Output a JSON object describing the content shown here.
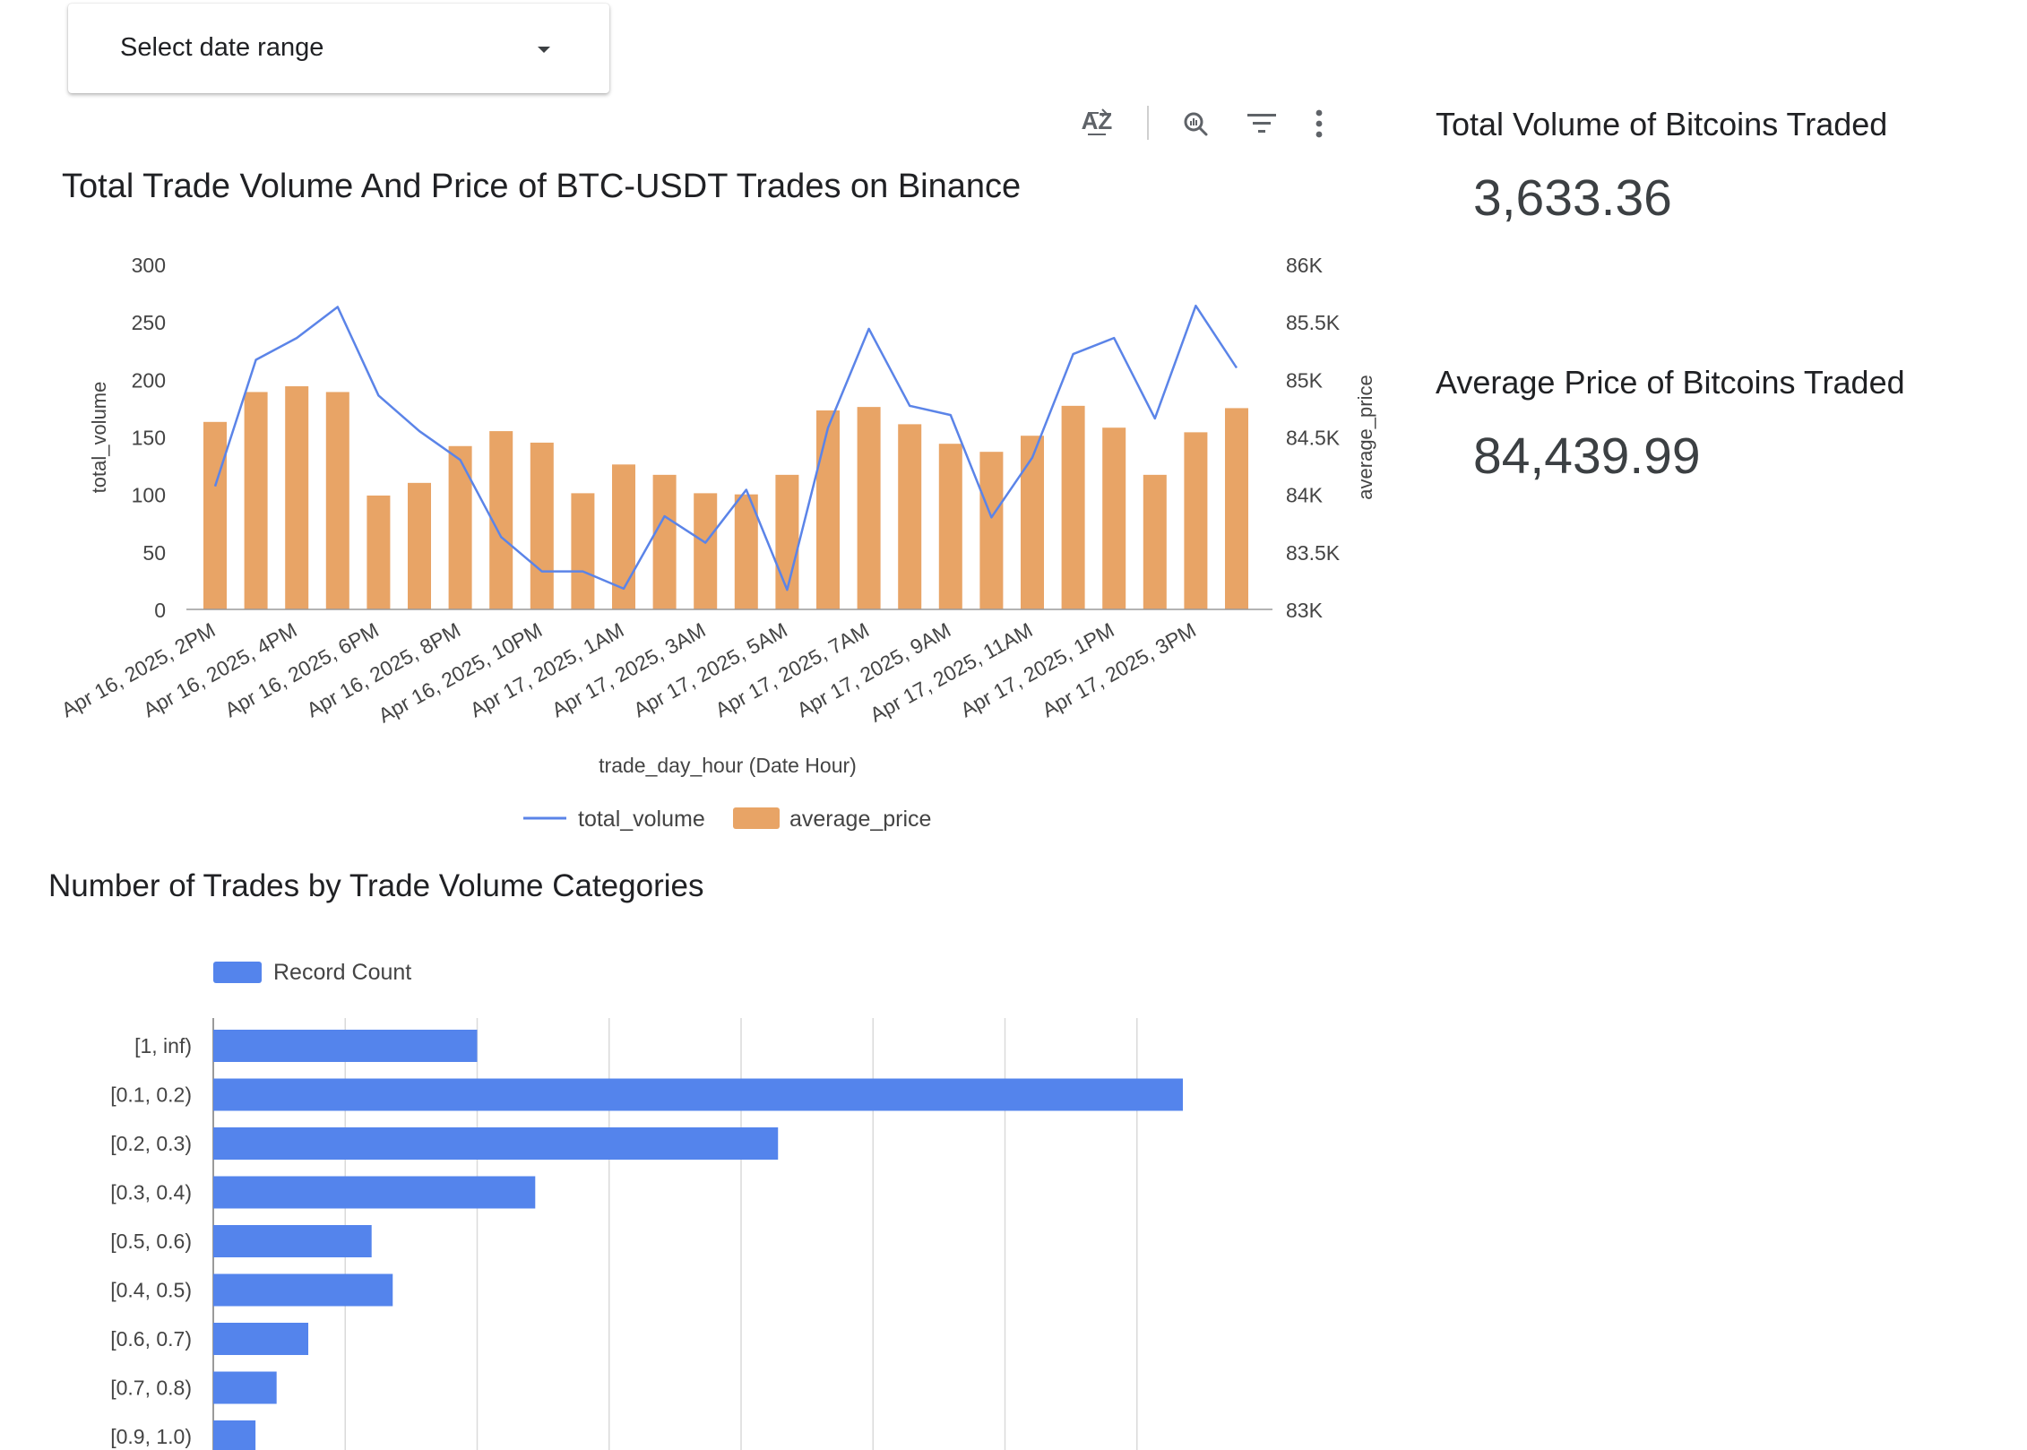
{
  "controls": {
    "date_range_label": "Select date range"
  },
  "toolbar": {
    "icons": [
      "sort-az-icon",
      "explore-chart-icon",
      "filter-icon",
      "more-vert-icon"
    ]
  },
  "scorecards": {
    "total_volume": {
      "title": "Total Volume of Bitcoins Traded",
      "value": "3,633.36"
    },
    "average_price": {
      "title": "Average Price of Bitcoins Traded",
      "value": "84,439.99"
    }
  },
  "colors": {
    "line": "#5b84e8",
    "bar_orange": "#e8a466",
    "bar_blue": "#5484ec",
    "grid": "#dadada",
    "axis": "#9a9a9a",
    "tick_text": "#444444"
  },
  "chart_data": [
    {
      "type": "bar",
      "title": "Total Trade Volume And Price of BTC-USDT Trades on Binance",
      "xlabel": "trade_day_hour (Date Hour)",
      "ylabel": "total_volume",
      "y2label": "average_price",
      "ylim": [
        0,
        300
      ],
      "yticks": [
        0,
        50,
        100,
        150,
        200,
        250,
        300
      ],
      "y2lim": [
        83000,
        86000
      ],
      "y2ticks": [
        "83K",
        "83.5K",
        "84K",
        "84.5K",
        "85K",
        "85.5K",
        "86K"
      ],
      "x_tick_labels": [
        "Apr 16, 2025, 2PM",
        "Apr 16, 2025, 4PM",
        "Apr 16, 2025, 6PM",
        "Apr 16, 2025, 8PM",
        "Apr 16, 2025, 10PM",
        "Apr 17, 2025, 1AM",
        "Apr 17, 2025, 3AM",
        "Apr 17, 2025, 5AM",
        "Apr 17, 2025, 7AM",
        "Apr 17, 2025, 9AM",
        "Apr 17, 2025, 11AM",
        "Apr 17, 2025, 1PM",
        "Apr 17, 2025, 3PM"
      ],
      "legend_position": "bottom",
      "series": [
        {
          "name": "total_volume",
          "kind": "line",
          "axis": "left",
          "values": [
            107,
            217,
            236,
            263,
            186,
            155,
            130,
            63,
            33,
            33,
            18,
            81,
            58,
            104,
            17,
            158,
            244,
            177,
            169,
            80,
            132,
            222,
            236,
            166,
            264,
            210
          ]
        },
        {
          "name": "average_price",
          "kind": "bar",
          "axis": "right",
          "values": [
            84630,
            84890,
            84940,
            84890,
            83990,
            84100,
            84420,
            84550,
            84450,
            84010,
            84260,
            84170,
            84010,
            84000,
            84170,
            84730,
            84760,
            84610,
            84440,
            84370,
            84510,
            84770,
            84580,
            84170,
            84540,
            84750
          ]
        }
      ]
    },
    {
      "type": "bar",
      "orientation": "horizontal",
      "title": "Number of Trades by Trade Volume Categories",
      "legend_position": "top-left",
      "xlim": [
        0,
        45
      ],
      "grid": true,
      "categories": [
        "[1, inf)",
        "[0.1, 0.2)",
        "[0.2, 0.3)",
        "[0.3, 0.4)",
        "[0.5, 0.6)",
        "[0.4, 0.5)",
        "[0.6, 0.7)",
        "[0.7, 0.8)",
        "[0.9, 1.0)"
      ],
      "series": [
        {
          "name": "Record Count",
          "values": [
            5,
            41,
            10.7,
            6.1,
            3,
            3.4,
            1.8,
            1.2,
            0.8
          ]
        }
      ]
    }
  ]
}
